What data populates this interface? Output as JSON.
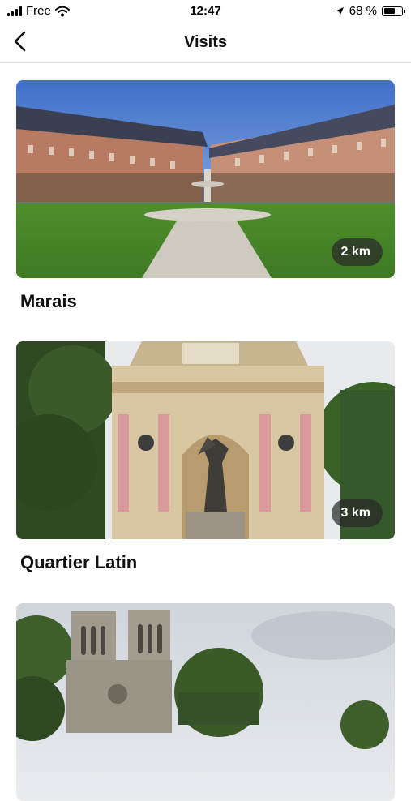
{
  "status_bar": {
    "carrier": "Free",
    "time": "12:47",
    "battery_text": "68 %",
    "battery_level": 0.68
  },
  "header": {
    "title": "Visits",
    "back_icon": "chevron-left-icon"
  },
  "visits": [
    {
      "name": "Marais",
      "distance": "2 km",
      "image": "place-des-vosges-photo"
    },
    {
      "name": "Quartier Latin",
      "distance": "3 km",
      "image": "fontaine-saint-michel-photo"
    },
    {
      "name": "",
      "distance": "",
      "image": "notre-dame-photo"
    }
  ],
  "colors": {
    "badge_bg": "#2f2f2f",
    "text": "#111111",
    "divider": "#e3e3e3"
  }
}
